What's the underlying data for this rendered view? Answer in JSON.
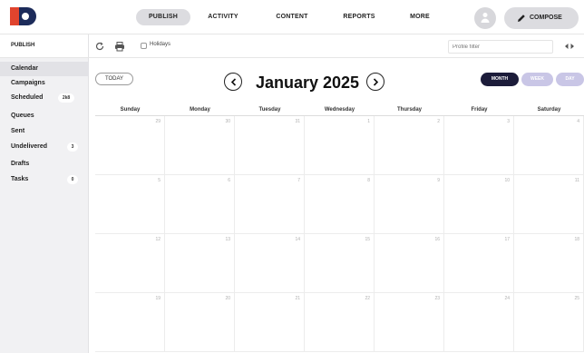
{
  "nav": {
    "items": [
      {
        "label": "PUBLISH",
        "active": true
      },
      {
        "label": "ACTIVITY",
        "active": false
      },
      {
        "label": "CONTENT",
        "active": false
      },
      {
        "label": "REPORTS",
        "active": false
      },
      {
        "label": "MORE",
        "active": false
      }
    ],
    "compose_label": "COMPOSE"
  },
  "sidebar": {
    "title": "PUBLISH",
    "items": [
      {
        "label": "Calendar",
        "badge": "",
        "active": true
      },
      {
        "label": "Campaigns",
        "badge": "",
        "active": false
      },
      {
        "label": "Scheduled",
        "badge": "2k8",
        "active": false
      },
      {
        "label": "Queues",
        "badge": "",
        "active": false
      },
      {
        "label": "Sent",
        "badge": "",
        "active": false
      },
      {
        "label": "Undelivered",
        "badge": "3",
        "active": false
      },
      {
        "label": "Drafts",
        "badge": "",
        "active": false
      },
      {
        "label": "Tasks",
        "badge": "0",
        "active": false
      }
    ]
  },
  "toolbar": {
    "holidays_label": "Holidays",
    "holidays_checked": false,
    "filter_placeholder": "Profile filter"
  },
  "calendar": {
    "today_label": "TODAY",
    "month_title": "January 2025",
    "views": [
      {
        "label": "MONTH",
        "active": true
      },
      {
        "label": "WEEK",
        "active": false
      },
      {
        "label": "DAY",
        "active": false
      }
    ],
    "weekdays": [
      "Sunday",
      "Monday",
      "Tuesday",
      "Wednesday",
      "Thursday",
      "Friday",
      "Saturday"
    ],
    "weeks": [
      [
        "29",
        "30",
        "31",
        "1",
        "2",
        "3",
        "4"
      ],
      [
        "5",
        "6",
        "7",
        "8",
        "9",
        "10",
        "11"
      ],
      [
        "12",
        "13",
        "14",
        "15",
        "16",
        "17",
        "18"
      ],
      [
        "19",
        "20",
        "21",
        "22",
        "23",
        "24",
        "25"
      ]
    ]
  },
  "colors": {
    "accent_dark": "#1c1c3a",
    "accent_light": "#c9c6e6",
    "logo_red": "#e0442e",
    "logo_navy": "#1c2b5a"
  }
}
